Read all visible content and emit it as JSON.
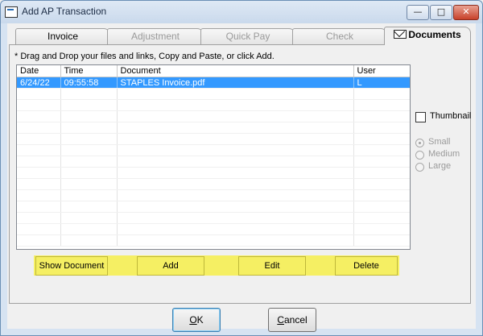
{
  "window": {
    "title": "Add AP Transaction",
    "controls": {
      "minimize": "—",
      "maximize": "□",
      "close": "✕"
    }
  },
  "tabs": [
    {
      "label": "Invoice",
      "state": "enabled"
    },
    {
      "label": "Adjustment",
      "state": "disabled"
    },
    {
      "label": "Quick Pay",
      "state": "disabled"
    },
    {
      "label": "Check",
      "state": "disabled"
    },
    {
      "label": "Documents",
      "state": "active",
      "icon": "envelope-icon"
    }
  ],
  "documents": {
    "hint": "* Drag and Drop your files and links, Copy and Paste, or click Add.",
    "columns": [
      "Date",
      "Time",
      "Document",
      "User"
    ],
    "rows": [
      {
        "date": "6/24/22",
        "time": "09:55:58",
        "document": "STAPLES Invoice.pdf",
        "user": "L",
        "selected": true
      }
    ],
    "thumbnail_label": "Thumbnail",
    "thumbnail_checked": false,
    "size_options": [
      {
        "label": "Small",
        "checked": true
      },
      {
        "label": "Medium",
        "checked": false
      },
      {
        "label": "Large",
        "checked": false
      }
    ],
    "buttons": {
      "show_document": "Show Document",
      "add": "Add",
      "edit": "Edit",
      "delete": "Delete"
    },
    "highlight_color": "#f5ef63"
  },
  "footer": {
    "ok_label": "OK",
    "ok_mnemonic": "O",
    "ok_rest": "K",
    "cancel_label": "Cancel",
    "cancel_mnemonic": "C",
    "cancel_rest": "ancel"
  },
  "colors": {
    "selection": "#3399ff",
    "window_frame": "#d6e3f2",
    "close_button": "#c8412a"
  }
}
